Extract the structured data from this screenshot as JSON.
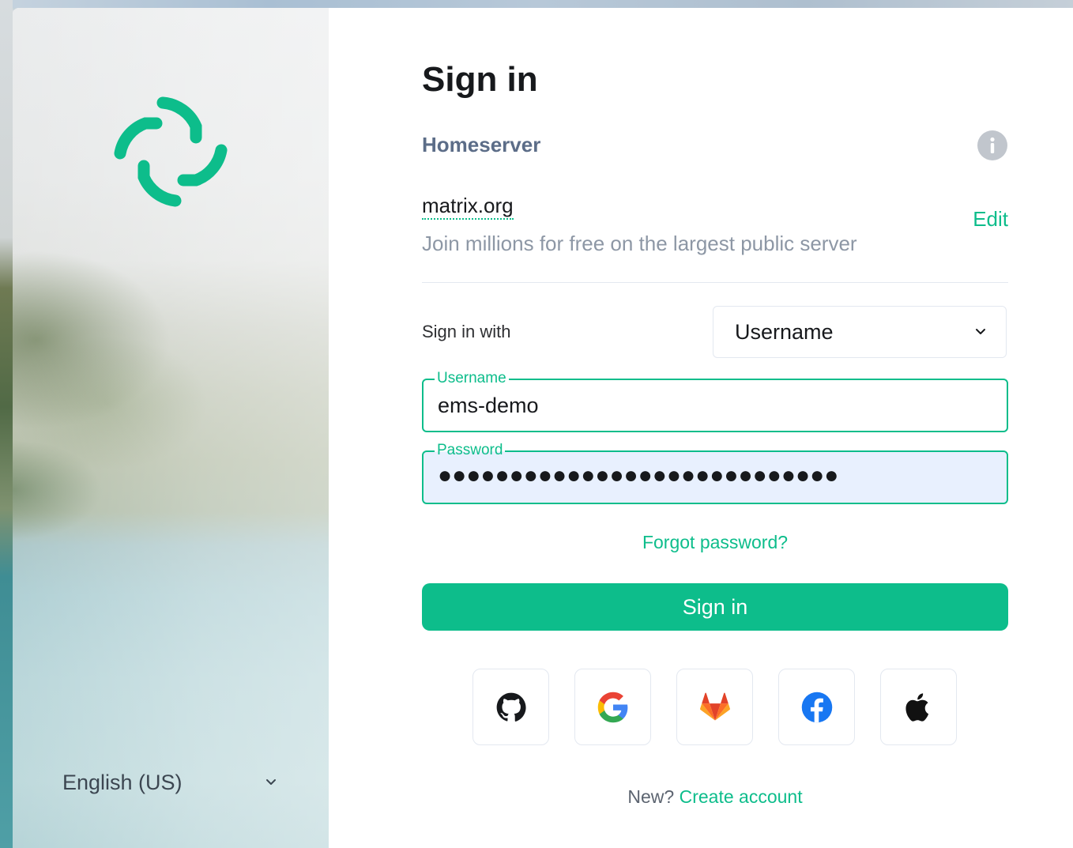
{
  "aside": {
    "language": "English (US)",
    "logo_color": "#0dbd8b"
  },
  "main": {
    "title": "Sign in",
    "homeserver_label": "Homeserver",
    "homeserver_name": "matrix.org",
    "homeserver_description": "Join millions for free on the largest public server",
    "edit_label": "Edit",
    "sign_in_with_label": "Sign in with",
    "sign_in_with_selected": "Username",
    "username_label": "Username",
    "username_value": "ems-demo",
    "password_label": "Password",
    "password_value": "●●●●●●●●●●●●●●●●●●●●●●●●●●●●",
    "forgot_password": "Forgot password?",
    "sign_in_button": "Sign in",
    "sso_providers": [
      "github-icon",
      "google-icon",
      "gitlab-icon",
      "facebook-icon",
      "apple-icon"
    ],
    "footer_new": "New?",
    "footer_create": "Create account"
  },
  "colors": {
    "accent": "#0dbd8b",
    "password_bg": "#e8f0fe",
    "title": "#17191c",
    "muted": "#8d97a5"
  }
}
